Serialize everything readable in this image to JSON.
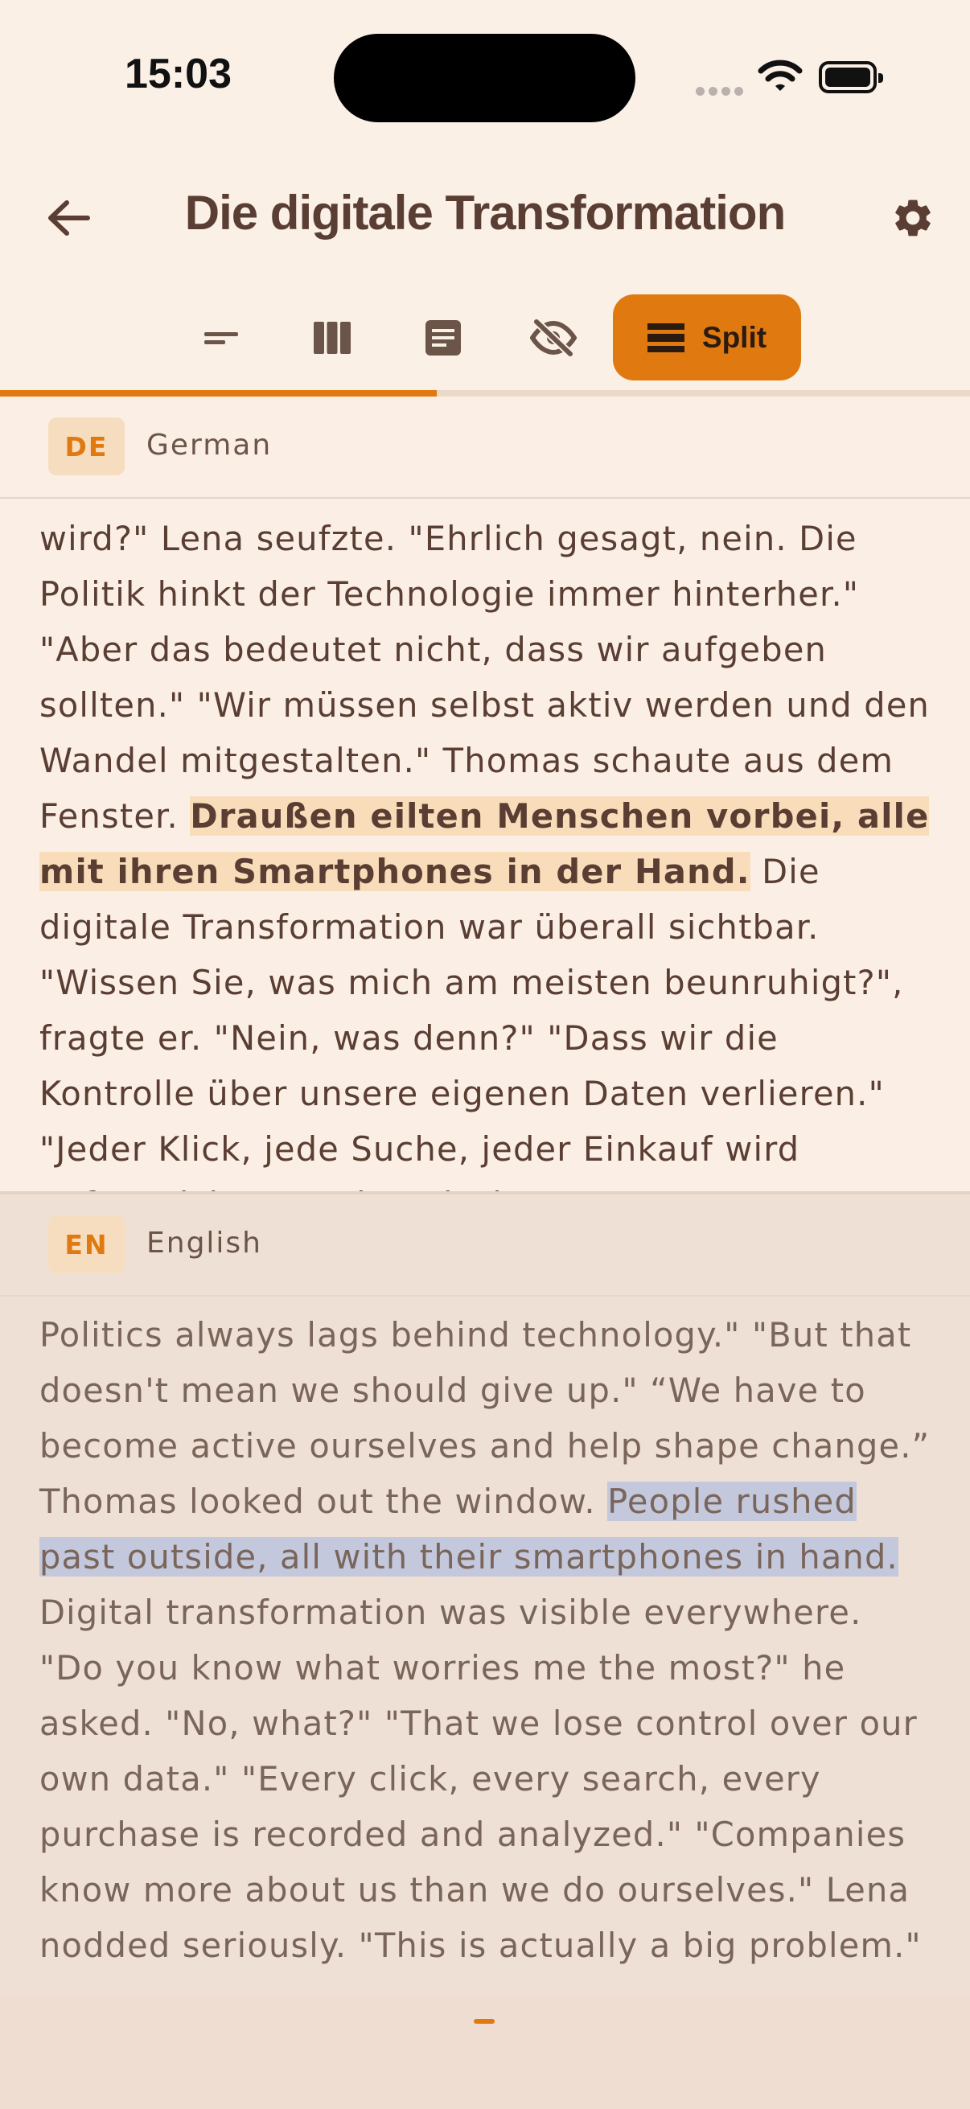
{
  "status_bar": {
    "time": "15:03"
  },
  "header": {
    "title": "Die digitale Transformation",
    "back_icon": "arrow-left-icon",
    "settings_icon": "gear-icon"
  },
  "toolbar": {
    "modes": [
      {
        "icon": "single-line-icon"
      },
      {
        "icon": "columns-icon"
      },
      {
        "icon": "document-icon"
      },
      {
        "icon": "eye-off-icon"
      }
    ],
    "split_label": "Split",
    "active_mode": "Split"
  },
  "reading_progress": 0.45,
  "source_pane": {
    "badge": "DE",
    "language": "German",
    "text_before": "wird?\" Lena seufzte. \"Ehrlich gesagt, nein. Die Politik hinkt der Technologie immer hinterher.\" \"Aber das bedeutet nicht, dass wir aufgeben sollten.\" \"Wir müssen selbst aktiv werden und den Wandel mitgestalten.\" Thomas schaute aus dem Fenster. ",
    "highlight": "Draußen eilten Menschen vorbei, alle mit ihren Smartphones in der Hand.",
    "text_after": " Die digitale Transformation war überall sichtbar. \"Wissen Sie, was mich am meisten beunruhigt?\", fragte er. \"Nein, was denn?\" \"Dass wir die Kontrolle über unsere eigenen Daten verlieren.\" \"Jeder Klick, jede Suche, jeder Einkauf wird aufgezeichnet und analysiert.\""
  },
  "target_pane": {
    "badge": "EN",
    "language": "English",
    "text_before": "Politics always lags behind technology.\" \"But that doesn't mean we should give up.\" “We have to become active ourselves and help shape change.” Thomas looked out the window. ",
    "highlight": "People rushed past outside, all with their smartphones in hand.",
    "text_after": " Digital transformation was visible everywhere. \"Do you know what worries me the most?\" he asked. \"No, what?\" \"That we lose control over our own data.\" \"Every click, every search, every purchase is recorded and analyzed.\" \"Companies know more about us than we do ourselves.\" Lena nodded seriously. \"This is actually a big problem.\""
  },
  "colors": {
    "accent": "#E07A10",
    "background": "#FAF0E6",
    "text": "#5A3E33",
    "highlight_source": "#F9DDBA",
    "highlight_target": "#C3C8DD"
  }
}
